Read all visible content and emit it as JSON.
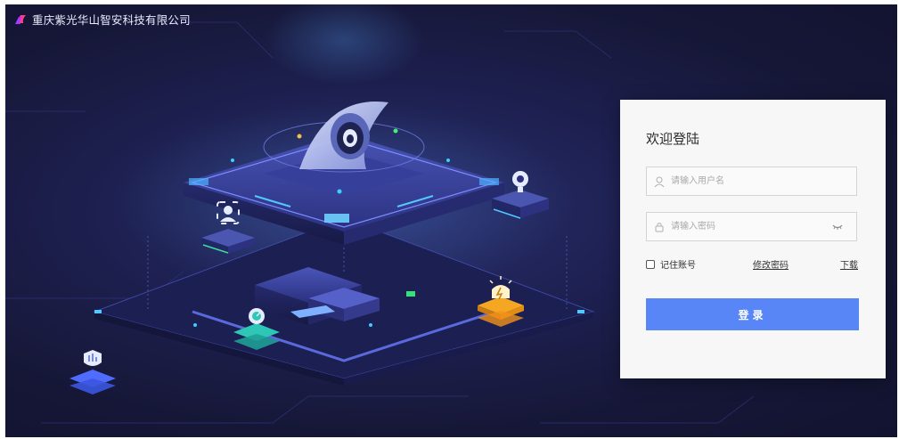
{
  "brand": {
    "company_name": "重庆紫光华山智安科技有限公司",
    "logo_icon": "ribbon-logo-icon",
    "logo_colors": [
      "#a23cff",
      "#ff3d8b"
    ]
  },
  "login": {
    "title": "欢迎登陆",
    "username_placeholder": "请输入用户名",
    "password_placeholder": "请输入密码",
    "remember_label": "记住账号",
    "change_password_link": "修改密码",
    "download_link": "下载",
    "submit_label": "登录",
    "submit_color": "#5886f6"
  },
  "icons": {
    "username": "user-icon",
    "password": "lock-icon",
    "toggle_password": "eye-closed-icon"
  },
  "theme": {
    "background": "#1d2050",
    "panel_background": "#f7f7f7",
    "accent_blue": "#3aa2ff"
  }
}
